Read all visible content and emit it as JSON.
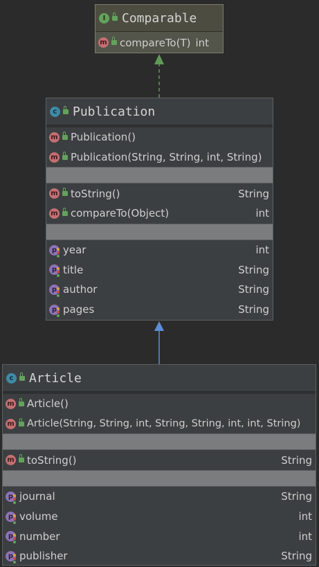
{
  "colors": {
    "background": "#2b2b2b",
    "implements_arrow": "#5f9a57",
    "extends_arrow": "#5b8fd6"
  },
  "comparable": {
    "kind_icon": "interface-icon",
    "name": "Comparable",
    "methods": [
      {
        "icon": "method-icon",
        "name": "compareTo(T)",
        "type": "int"
      }
    ]
  },
  "publication": {
    "kind_icon": "class-icon",
    "name": "Publication",
    "constructors": [
      {
        "icon": "method-icon",
        "name": "Publication()",
        "type": ""
      },
      {
        "icon": "method-icon",
        "name": "Publication(String, String, int, String)",
        "type": ""
      }
    ],
    "methods": [
      {
        "icon": "method-icon",
        "name": "toString()",
        "type": "String"
      },
      {
        "icon": "method-icon",
        "name": "compareTo(Object)",
        "type": "int"
      }
    ],
    "fields": [
      {
        "icon": "property-icon",
        "name": "year",
        "type": "int"
      },
      {
        "icon": "property-icon",
        "name": "title",
        "type": "String"
      },
      {
        "icon": "property-icon",
        "name": "author",
        "type": "String"
      },
      {
        "icon": "property-icon",
        "name": "pages",
        "type": "String"
      }
    ]
  },
  "article": {
    "kind_icon": "class-icon",
    "name": "Article",
    "constructors": [
      {
        "icon": "method-icon",
        "name": "Article()",
        "type": ""
      },
      {
        "icon": "method-icon",
        "name": "Article(String, String, int, String, String, int, int, String)",
        "type": ""
      }
    ],
    "methods": [
      {
        "icon": "method-icon",
        "name": "toString()",
        "type": "String"
      }
    ],
    "fields": [
      {
        "icon": "property-icon",
        "name": "journal",
        "type": "String"
      },
      {
        "icon": "property-icon",
        "name": "volume",
        "type": "int"
      },
      {
        "icon": "property-icon",
        "name": "number",
        "type": "int"
      },
      {
        "icon": "property-icon",
        "name": "publisher",
        "type": "String"
      }
    ]
  }
}
